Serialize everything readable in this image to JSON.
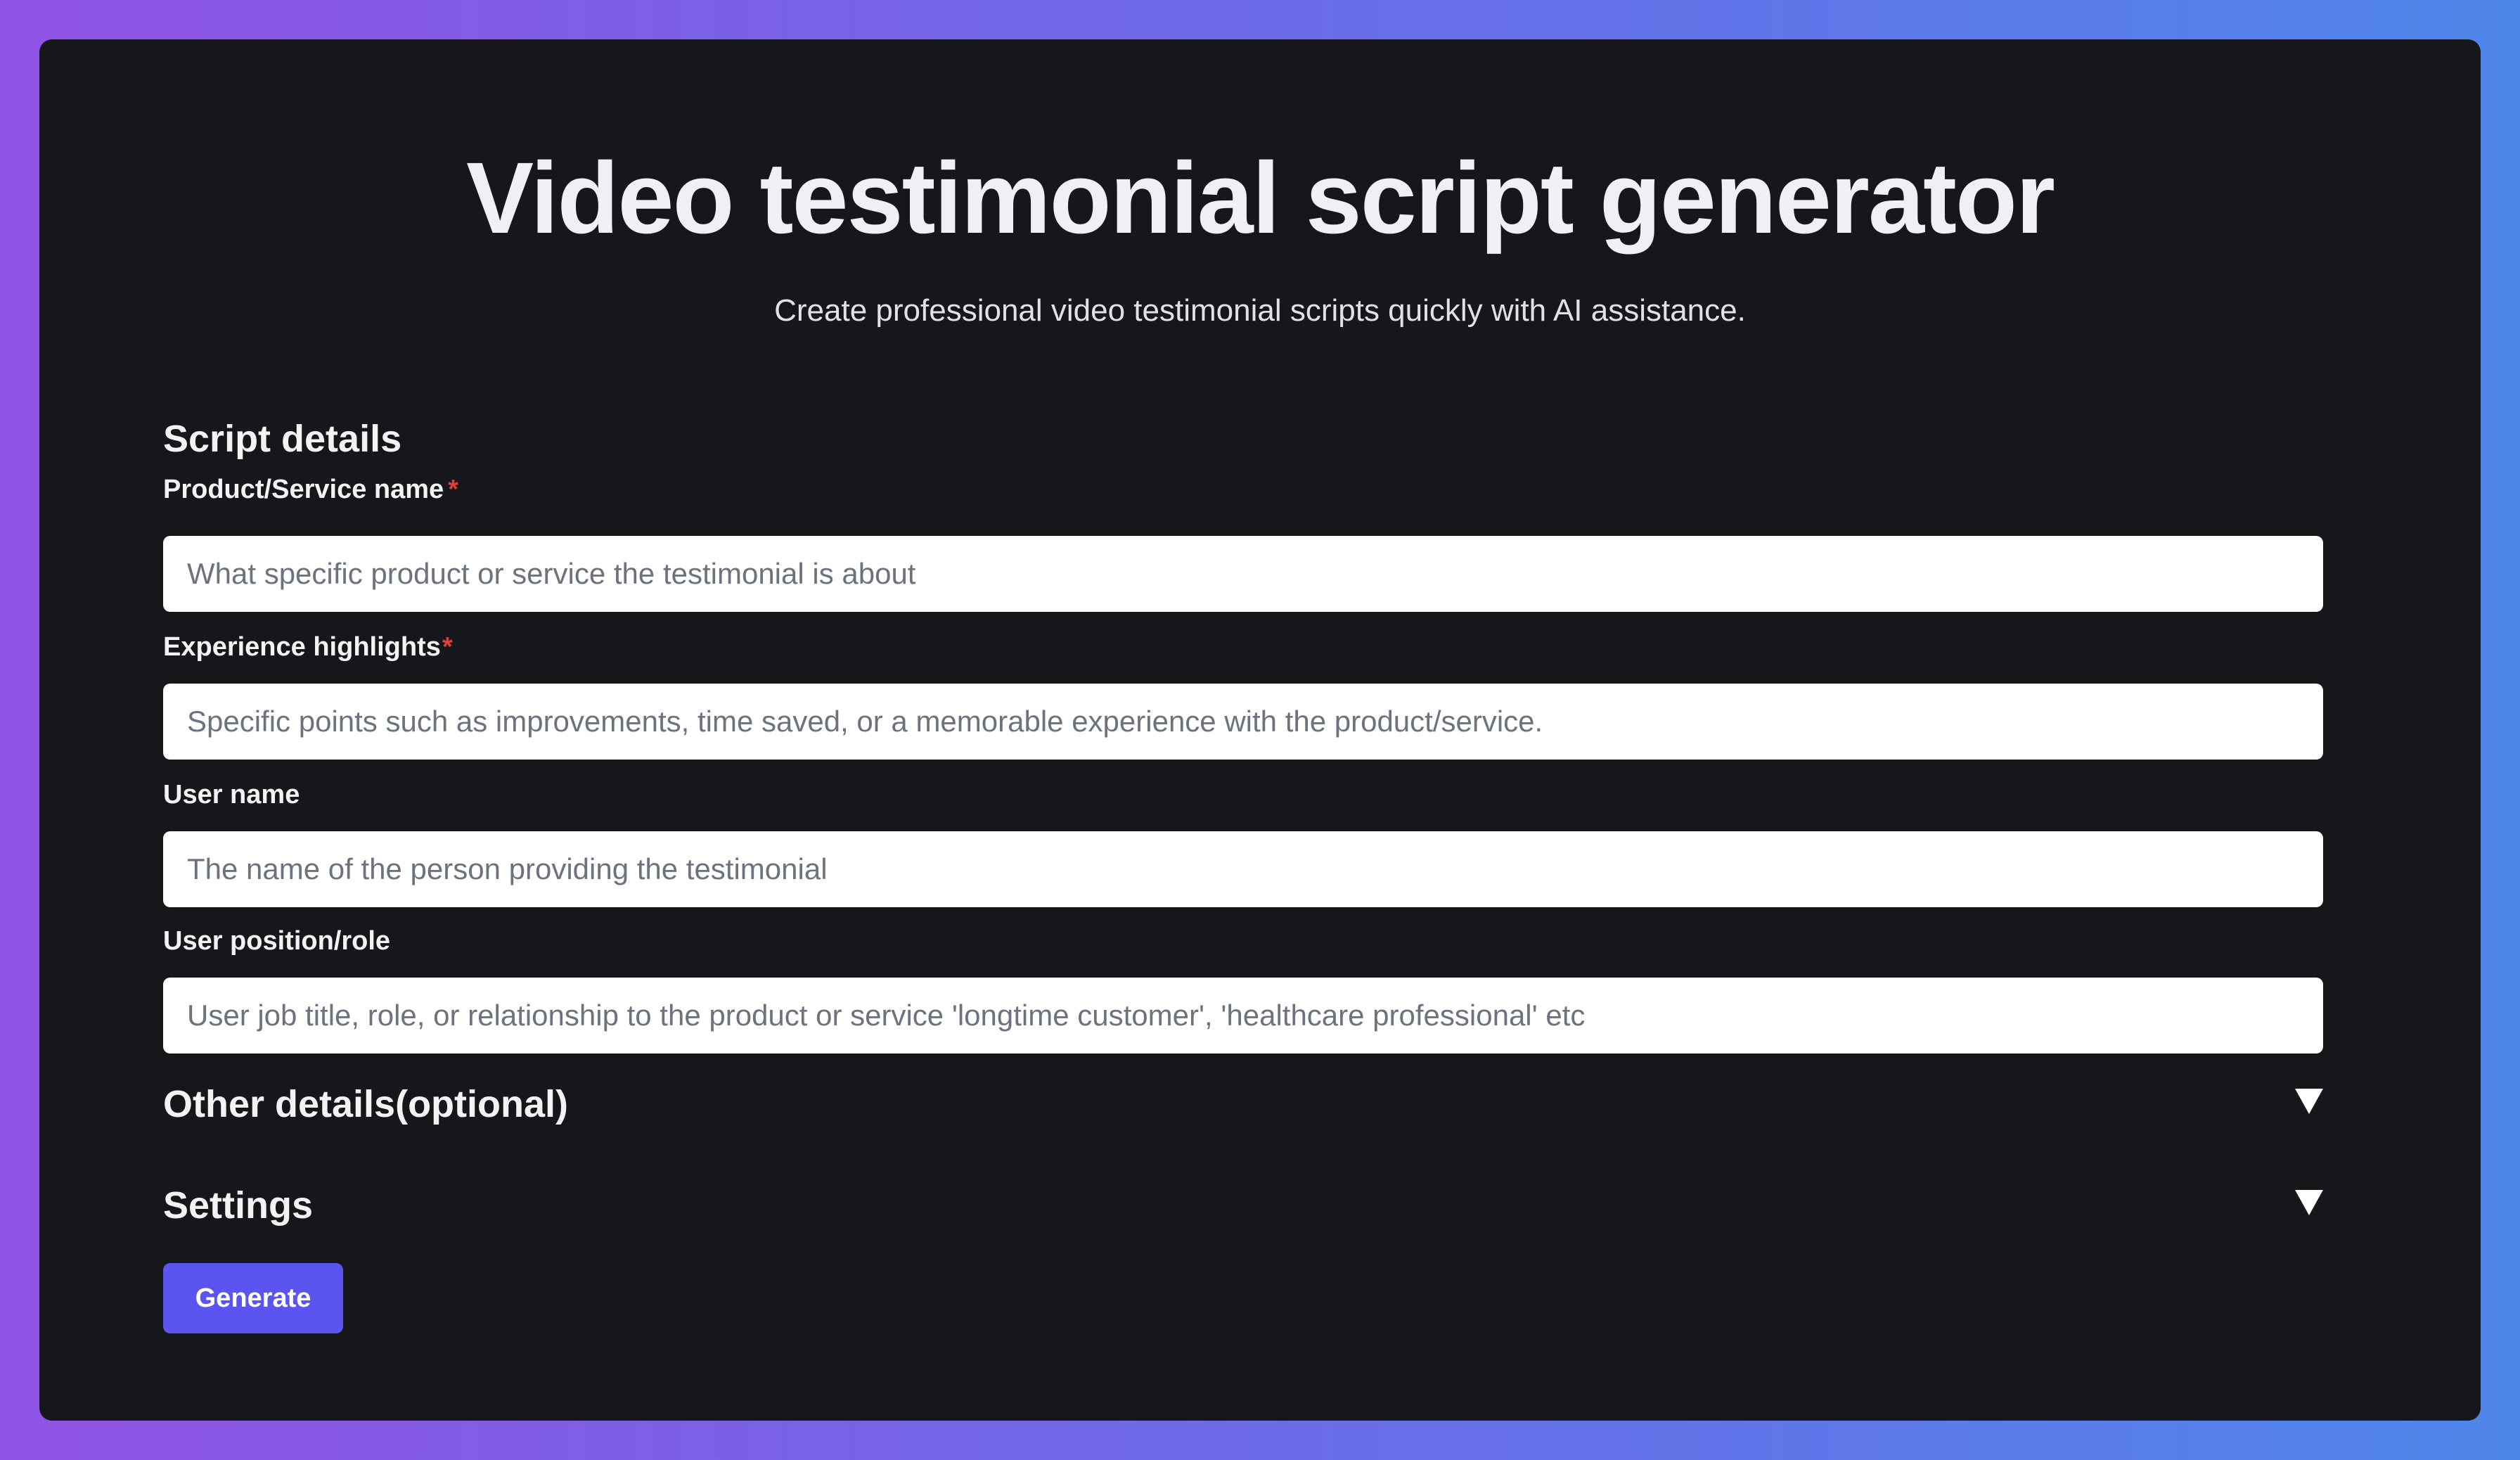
{
  "header": {
    "title": "Video testimonial script generator",
    "subtitle": "Create professional video testimonial scripts quickly with AI assistance."
  },
  "script_details": {
    "title": "Script details",
    "product": {
      "label": "Product/Service name",
      "required_mark": "*",
      "placeholder": "What specific product or service the testimonial is about"
    },
    "highlights": {
      "label": "Experience highlights",
      "required_mark": "*",
      "placeholder": "Specific points such as improvements, time saved, or a memorable experience with the product/service."
    },
    "user_name": {
      "label": "User name",
      "placeholder": "The name of the person providing the testimonial"
    },
    "user_role": {
      "label": "User position/role",
      "placeholder": "User job title, role, or relationship to the product or service 'longtime customer', 'healthcare professional' etc"
    }
  },
  "other_details": {
    "title": "Other details(optional)",
    "icon": "chevron-down-icon"
  },
  "settings": {
    "title": "Settings",
    "icon": "chevron-down-icon"
  },
  "actions": {
    "generate_label": "Generate"
  },
  "colors": {
    "card_background": "#16171a",
    "accent": "#5a55f0",
    "required": "#e43b3b",
    "gradient_start": "#9153e6",
    "gradient_end": "#4f86ea"
  }
}
